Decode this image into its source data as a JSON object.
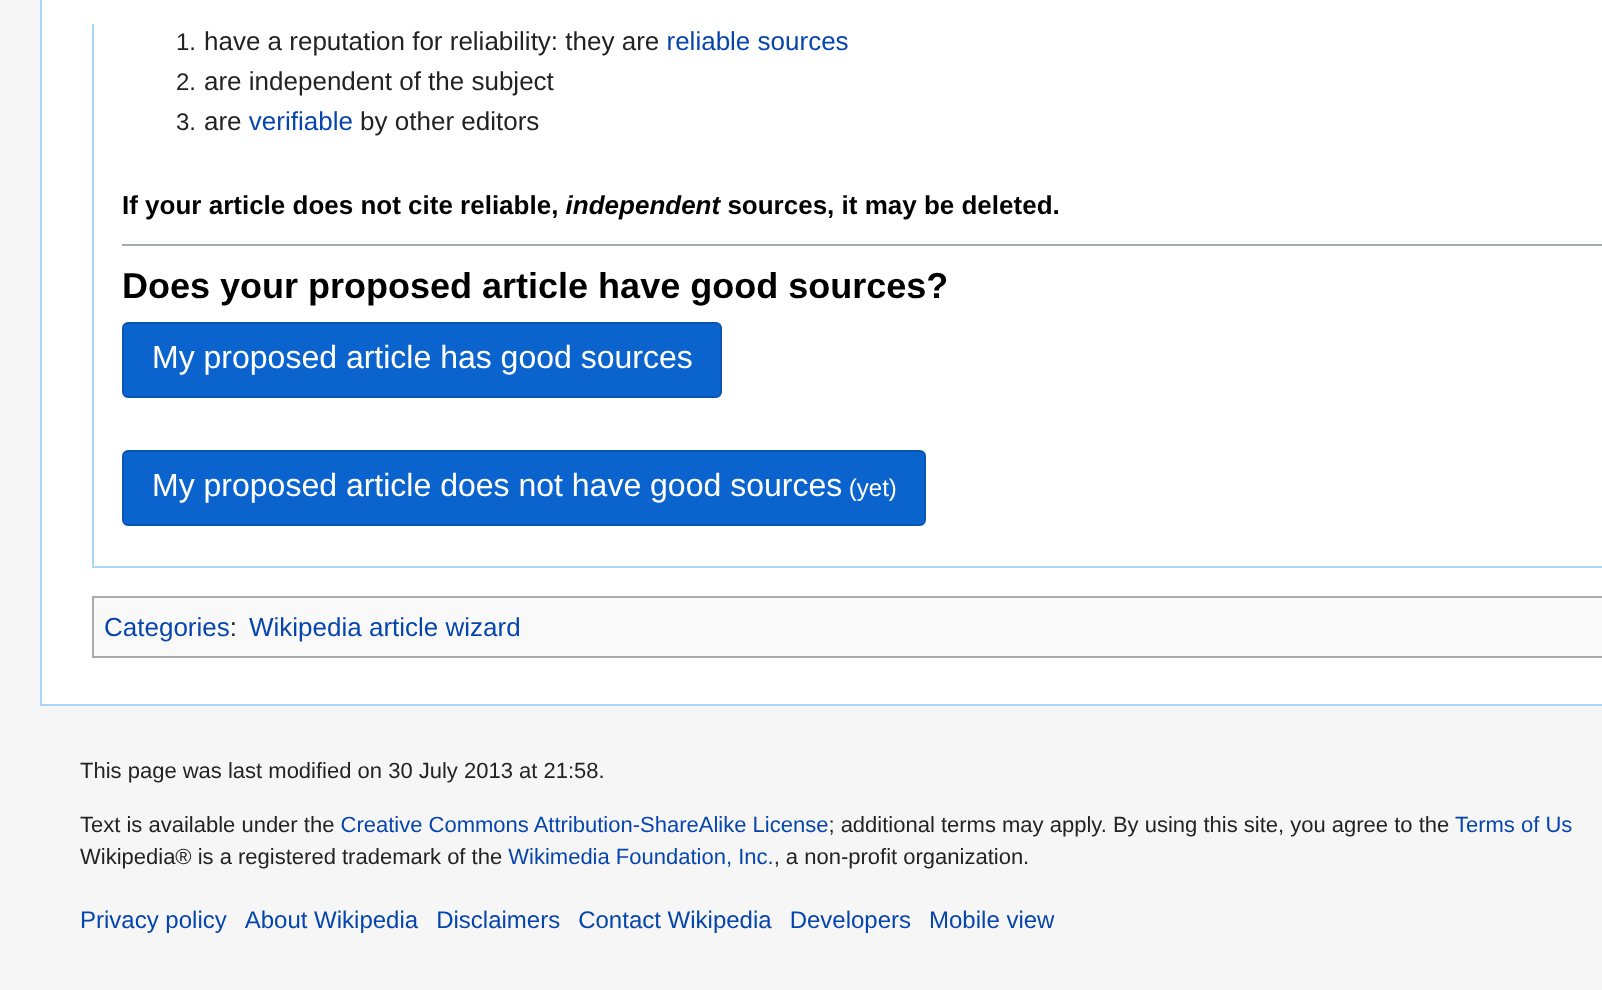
{
  "criteria_list": [
    {
      "number": "1.",
      "parts": [
        {
          "text": "have a reputation for reliability: they are ",
          "link": false
        },
        {
          "text": "reliable sources",
          "link": true
        }
      ]
    },
    {
      "number": "2.",
      "parts": [
        {
          "text": "are independent of the subject",
          "link": false
        }
      ]
    },
    {
      "number": "3.",
      "parts": [
        {
          "text": "are ",
          "link": false
        },
        {
          "text": "verifiable",
          "link": true
        },
        {
          "text": " by other editors",
          "link": false
        }
      ]
    }
  ],
  "warning": "If your article does not cite reliable, *independent* sources, it may be deleted.",
  "question": "Does your proposed article have good sources?",
  "buttons": [
    {
      "label": "My proposed article has good sources"
    },
    {
      "label": "My proposed article does not have good sources",
      "note": "(yet)"
    }
  ],
  "categories": {
    "label": "Categories",
    "separator": ":",
    "items": [
      "Wikipedia article wizard"
    ]
  },
  "footer": {
    "last_modified": "This page was last modified on 30 July 2013 at 21:58.",
    "license_lines": [
      [
        {
          "text": "Text is available under the ",
          "link": false
        },
        {
          "text": "Creative Commons Attribution-ShareAlike License",
          "link": true
        },
        {
          "text": "; additional terms may apply. By using this site, you agree to the ",
          "link": false
        },
        {
          "text": "Terms of Us",
          "link": true
        }
      ],
      [
        {
          "text": "Wikipedia® is a registered trademark of the ",
          "link": false
        },
        {
          "text": "Wikimedia Foundation, Inc.",
          "link": true
        },
        {
          "text": ", a non-profit organization.",
          "link": false
        }
      ]
    ],
    "links": [
      "Privacy policy",
      "About Wikipedia",
      "Disclaimers",
      "Contact Wikipedia",
      "Developers",
      "Mobile view"
    ]
  }
}
